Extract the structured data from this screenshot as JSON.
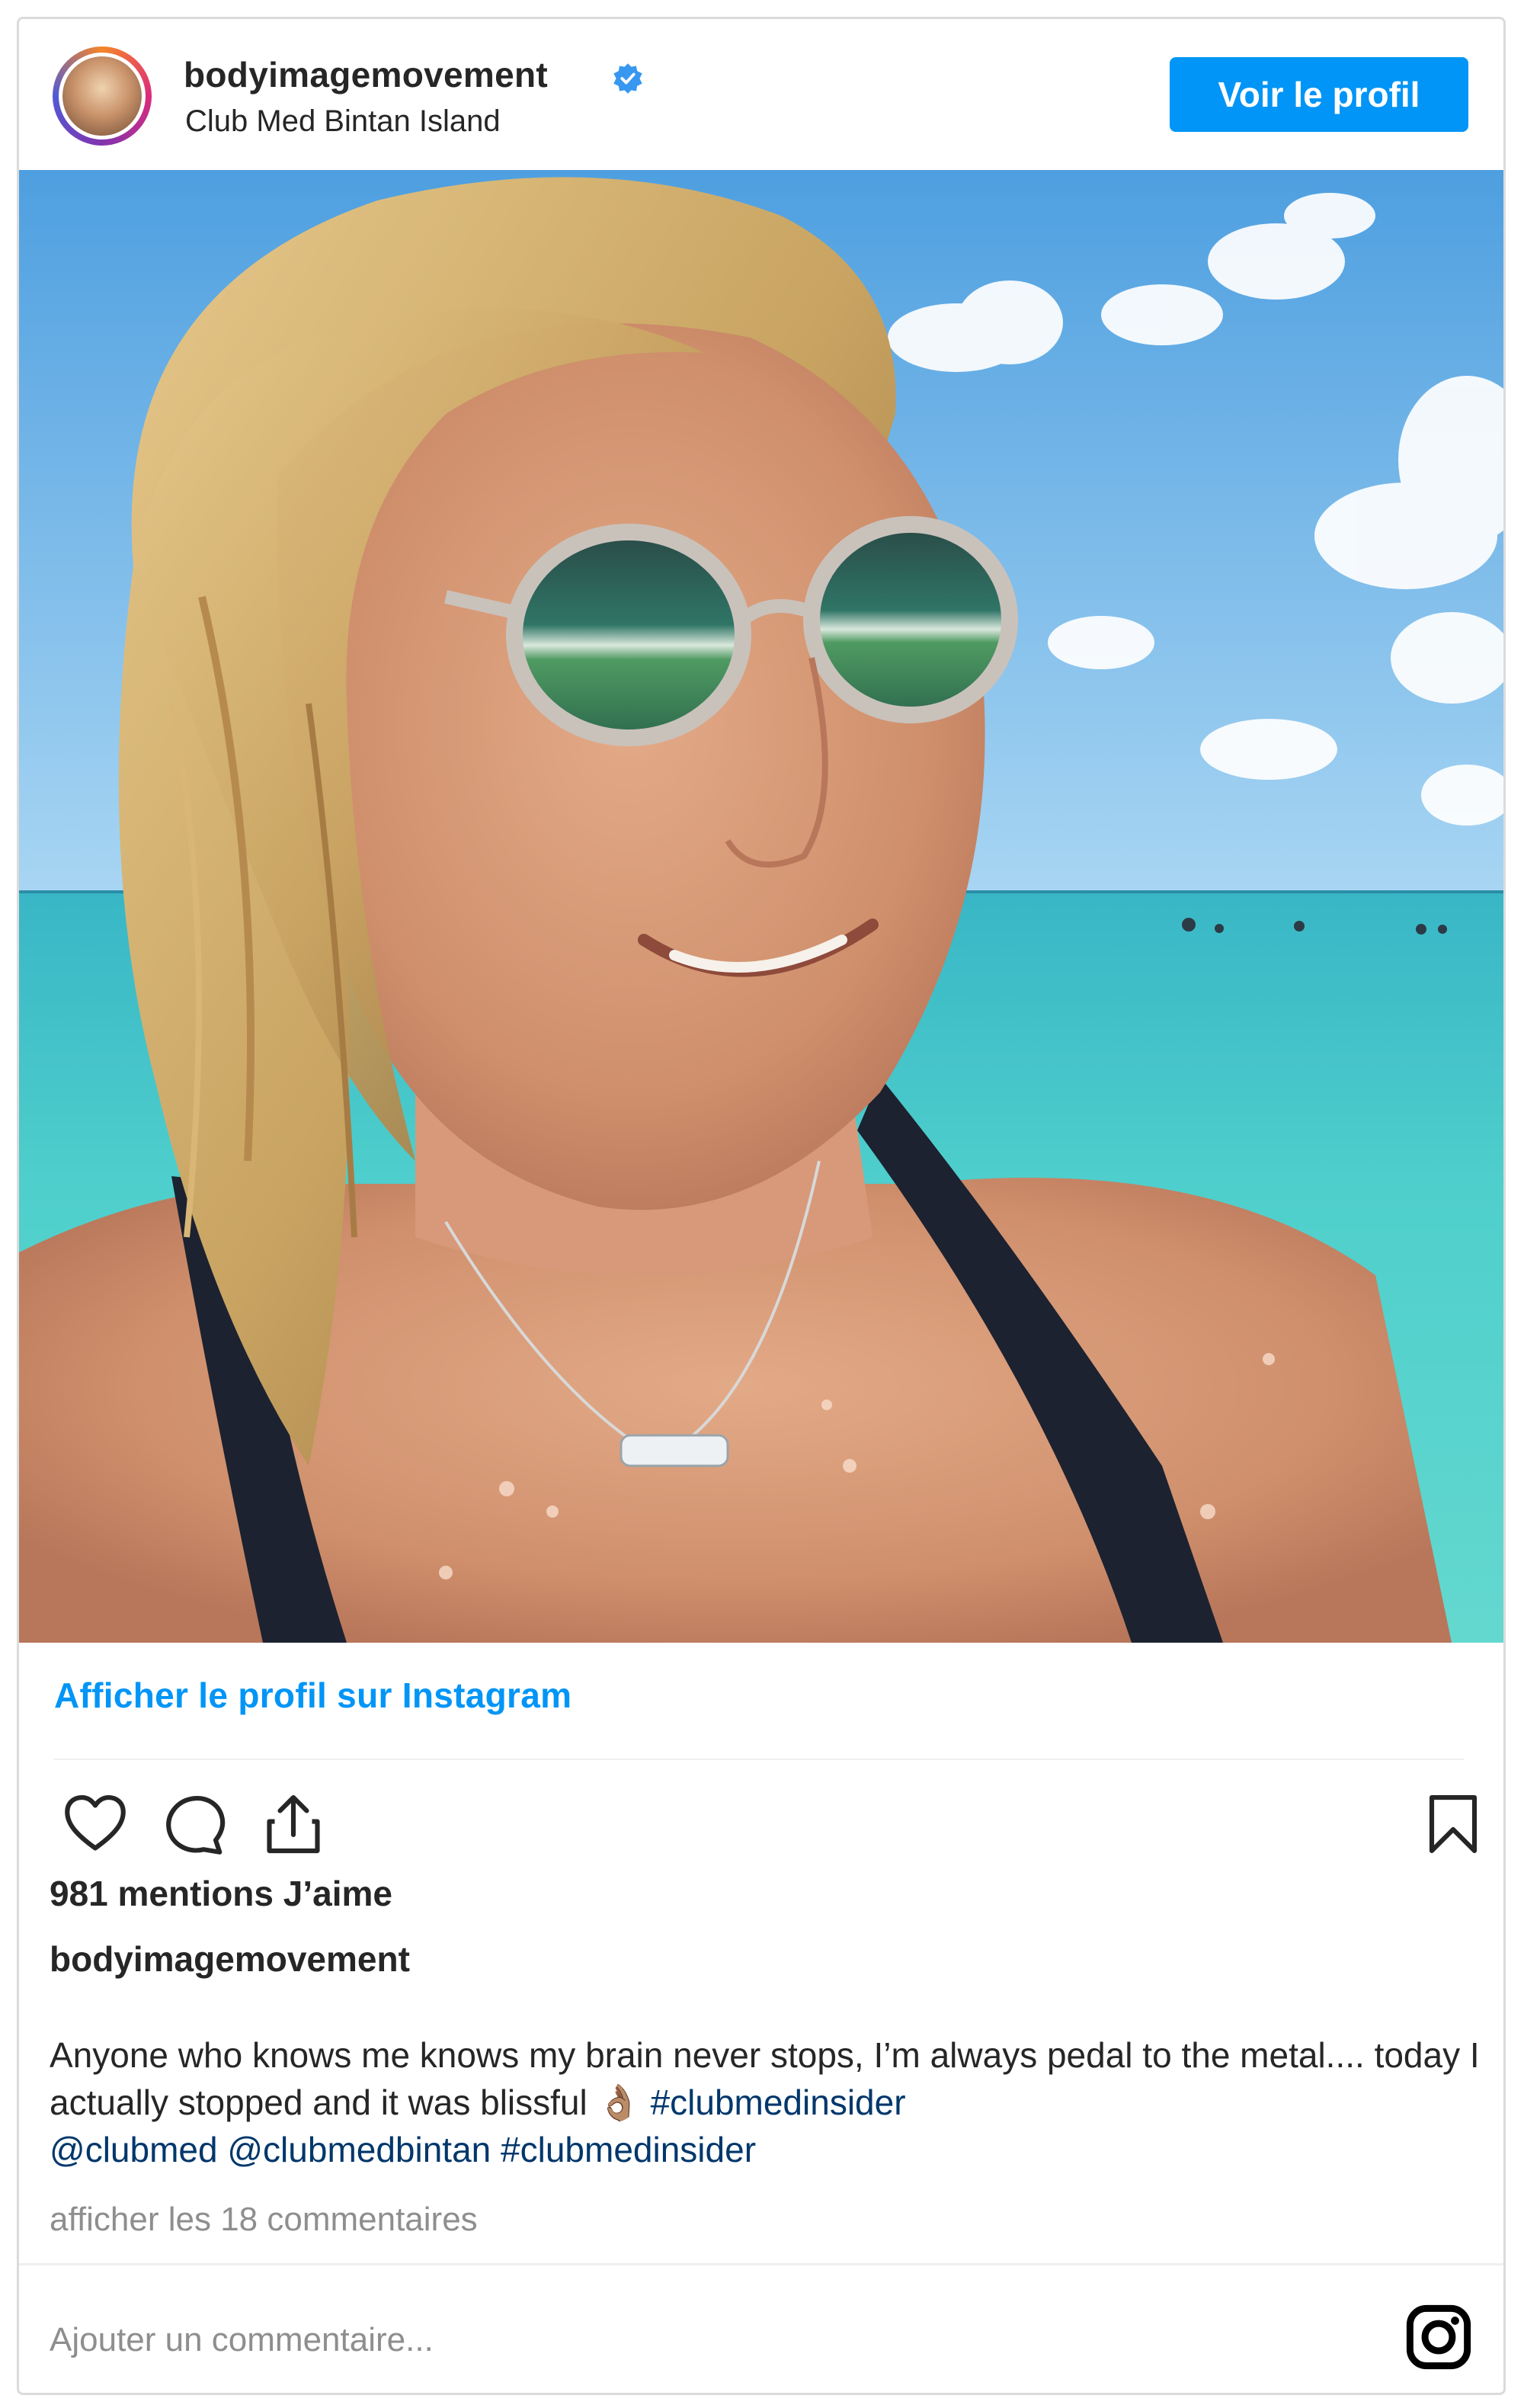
{
  "post": {
    "username": "bodyimagemovement",
    "location": "Club Med Bintan Island",
    "view_profile_button": "Voir le profil",
    "instagram_link": "Afficher le profil sur Instagram",
    "likes": "981 mentions J’aime",
    "caption_username": "bodyimagemovement",
    "caption_text": "Anyone who knows me knows my brain never stops, I’m always pedal to the metal.... today I actually stopped and it was blissful 👌🏽",
    "caption_tag_1": "#clubmedinsider",
    "caption_mention_1": "@clubmed",
    "caption_mention_2": "@clubmedbintan",
    "caption_tag_2": "#clubmedinsider",
    "view_comments": "afficher les 18 commentaires",
    "add_comment_placeholder": "Ajouter un commentaire..."
  },
  "colors": {
    "accent_blue": "#0095f6",
    "hashtag_blue": "#00376b",
    "muted_gray": "#8e8e8e"
  },
  "icons": {
    "verified": "verified-badge-icon",
    "like": "heart-icon",
    "comment": "comment-bubble-icon",
    "share": "share-icon",
    "save": "bookmark-icon",
    "brand": "instagram-icon"
  }
}
